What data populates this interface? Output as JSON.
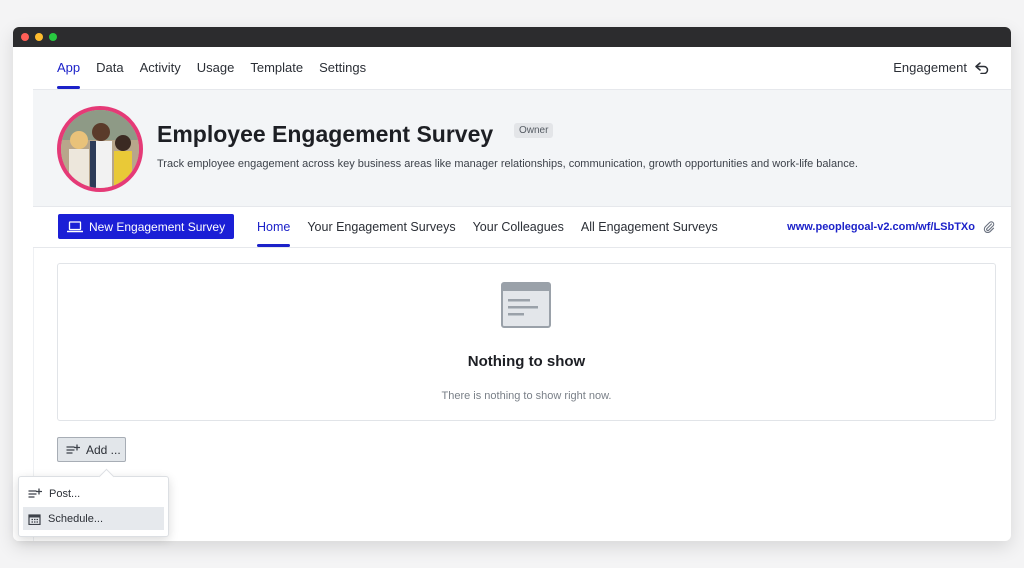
{
  "top_nav": {
    "tabs": [
      "App",
      "Data",
      "Activity",
      "Usage",
      "Template",
      "Settings"
    ],
    "active_tab": "App",
    "right_link": "Engagement"
  },
  "hero": {
    "title": "Employee Engagement Survey",
    "badge": "Owner",
    "description": "Track employee engagement across key business areas like manager relationships, communication, growth opportunities and work-life balance."
  },
  "sub_nav": {
    "new_button": "New Engagement Survey",
    "tabs": [
      "Home",
      "Your Engagement Surveys",
      "Your Colleagues",
      "All Engagement Surveys"
    ],
    "active_tab": "Home",
    "url": "www.peoplegoal-v2.com/wf/LSbTXo"
  },
  "empty_state": {
    "heading": "Nothing to show",
    "subtext": "There is nothing to show right now."
  },
  "add_button": {
    "label": "Add ..."
  },
  "add_menu": {
    "items": [
      {
        "label": "Post...",
        "icon": "post-add-icon",
        "highlighted": false
      },
      {
        "label": "Schedule...",
        "icon": "calendar-icon",
        "highlighted": true
      }
    ]
  },
  "colors": {
    "accent": "#1c22c9",
    "primary_button": "#1b1fd6",
    "avatar_ring": "#e53a77"
  }
}
